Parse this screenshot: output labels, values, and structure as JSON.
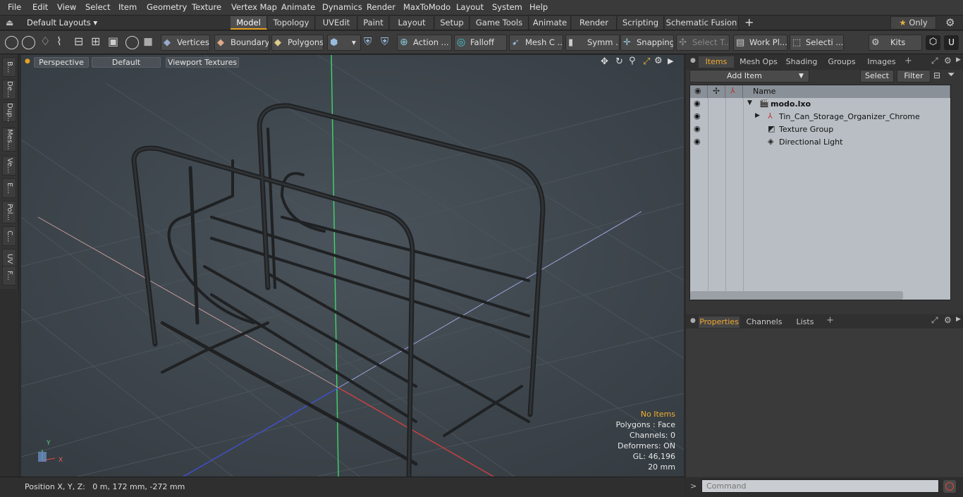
{
  "menu": [
    "File",
    "Edit",
    "View",
    "Select",
    "Item",
    "Geometry",
    "Texture",
    "Vertex Map",
    "Animate",
    "Dynamics",
    "Render",
    "MaxToModo",
    "Layout",
    "System",
    "Help"
  ],
  "layout_dropdown": "Default Layouts",
  "layout_tabs": [
    "Model",
    "Topology",
    "UVEdit",
    "Paint",
    "Layout",
    "Setup",
    "Game Tools",
    "Animate",
    "Render",
    "Scripting",
    "Schematic Fusion"
  ],
  "layout_tabs_active": "Model",
  "only_label": "Only",
  "toolbar": {
    "vertices": "Vertices",
    "boundary": "Boundary",
    "polygons": "Polygons",
    "action": "Action ...",
    "falloff": "Falloff",
    "mesh": "Mesh C ...",
    "symm": "Symm ...",
    "snapping": "Snapping",
    "select_t": "Select T...",
    "work_pl": "Work Pl...",
    "selecti": "Selecti ...",
    "kits": "Kits"
  },
  "left_tabs": [
    "B...",
    "De...",
    "Dup...",
    "Mes...",
    "Ve...",
    "E...",
    "Pol...",
    "C...",
    "UV",
    "F..."
  ],
  "viewport": {
    "view": "Perspective",
    "shading": "Default",
    "textures": "Viewport Textures",
    "stats": {
      "selection": "No Items",
      "polygons": "Polygons : Face",
      "channels": "Channels: 0",
      "deformers": "Deformers: ON",
      "gl": "GL: 46,196",
      "scale": "20 mm"
    },
    "axis_y": "Y",
    "axis_x": "X"
  },
  "status": {
    "position": "Position X, Y, Z:   0 m, 172 mm, -272 mm"
  },
  "panel_tabs": [
    "Items",
    "Mesh Ops",
    "Shading",
    "Groups",
    "Images"
  ],
  "panel_tab_active": "Items",
  "items_toolbar": {
    "add_item": "Add Item",
    "select": "Select",
    "filter": "Filter"
  },
  "items_header": {
    "name": "Name"
  },
  "items": [
    {
      "name": "modo.lxo",
      "bold": true
    },
    {
      "name": "Tin_Can_Storage_Organizer_Chrome"
    },
    {
      "name": "Texture Group"
    },
    {
      "name": "Directional Light"
    }
  ],
  "props_tabs": [
    "Properties",
    "Channels",
    "Lists"
  ],
  "props_tab_active": "Properties",
  "command_placeholder": "Command",
  "colors": {
    "accent": "#e6a020",
    "viewport_bg": "#3f474e",
    "list_bg": "#b8bec4"
  }
}
